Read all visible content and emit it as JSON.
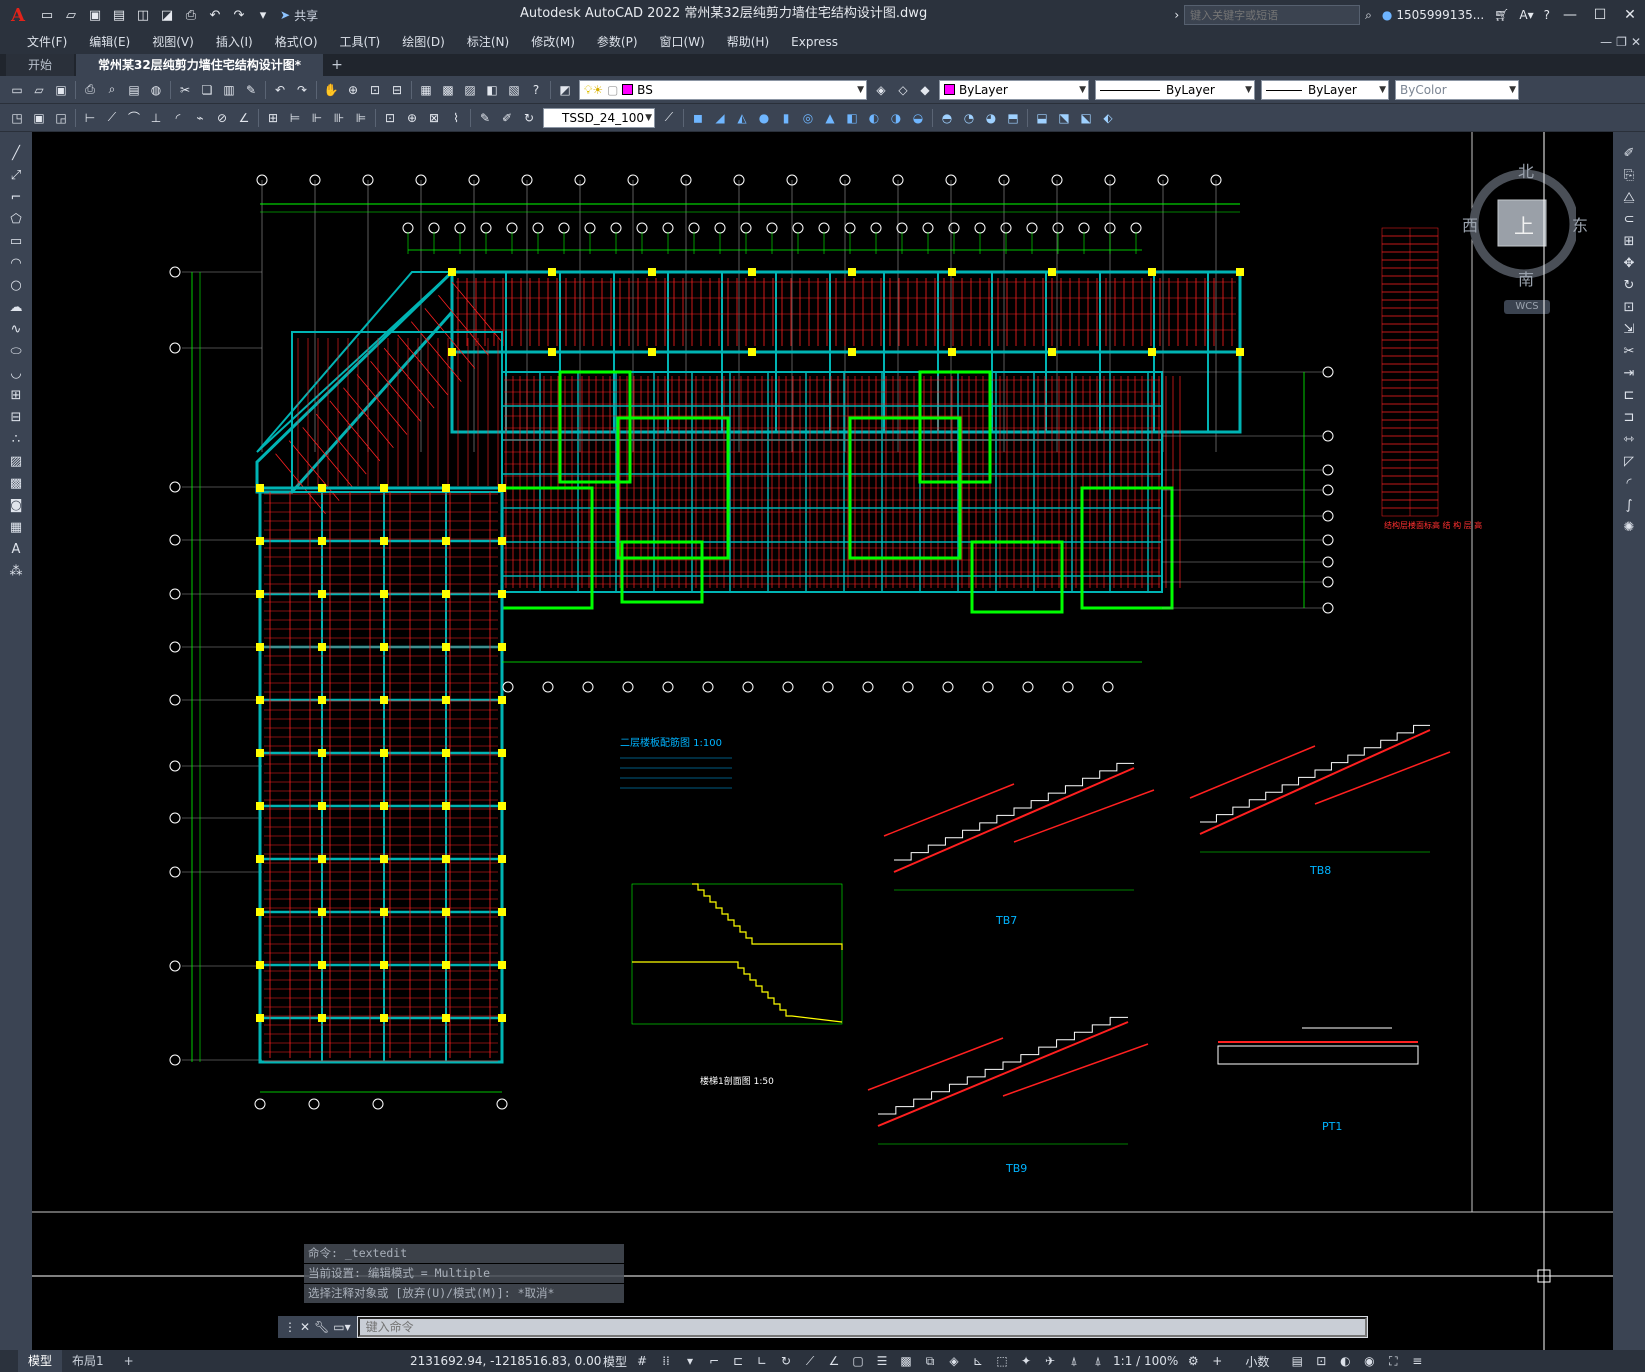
{
  "app": {
    "logo": "A",
    "title": "Autodesk AutoCAD 2022    常州某32层纯剪力墙住宅结构设计图.dwg",
    "share_label": "共享",
    "search_placeholder": "键入关键字或短语",
    "user": "1505999135...",
    "help": "?"
  },
  "menu": [
    "文件(F)",
    "编辑(E)",
    "视图(V)",
    "插入(I)",
    "格式(O)",
    "工具(T)",
    "绘图(D)",
    "标注(N)",
    "修改(M)",
    "参数(P)",
    "窗口(W)",
    "帮助(H)",
    "Express"
  ],
  "tabs": [
    {
      "label": "开始",
      "active": false
    },
    {
      "label": "常州某32层纯剪力墙住宅结构设计图*",
      "active": true
    }
  ],
  "toolbar1": {
    "layer": "BS",
    "color": "ByLayer",
    "linetype": "ByLayer",
    "lineweight": "ByLayer",
    "plotstyle": "ByColor"
  },
  "toolbar2": {
    "text_style": "TSSD_24_100"
  },
  "viewcube": {
    "north": "北",
    "south": "南",
    "east": "东",
    "west": "西",
    "top": "上",
    "wcs": "WCS"
  },
  "drawing_texts": {
    "stair_plan_title": "二层楼板配筋图",
    "stair_scale": "1:100",
    "section_title": "楼梯1剖面图",
    "section_scale": "1:50",
    "tb7": "TB7",
    "tb8": "TB8",
    "tb9": "TB9",
    "pt1": "PT1",
    "table_caption": "结构层楼面标高 结 构 层 高"
  },
  "command": {
    "history": [
      "命令: _textedit",
      "当前设置: 编辑模式 = Multiple",
      "选择注释对象或 [放弃(U)/模式(M)]: *取消*"
    ],
    "placeholder": "键入命令"
  },
  "status": {
    "tabs": [
      {
        "label": "模型",
        "active": true
      },
      {
        "label": "布局1",
        "active": false
      }
    ],
    "coords": "2131692.94, -1218516.83, 0.00",
    "model": "模型",
    "scale": "1:1 / 100%",
    "units": "小数"
  },
  "colors": {
    "wall": "#00b4b4",
    "rebar": "#ff2020",
    "grid": "#00ff00",
    "column": "#ffff00",
    "frame": "#c8c8c8"
  }
}
